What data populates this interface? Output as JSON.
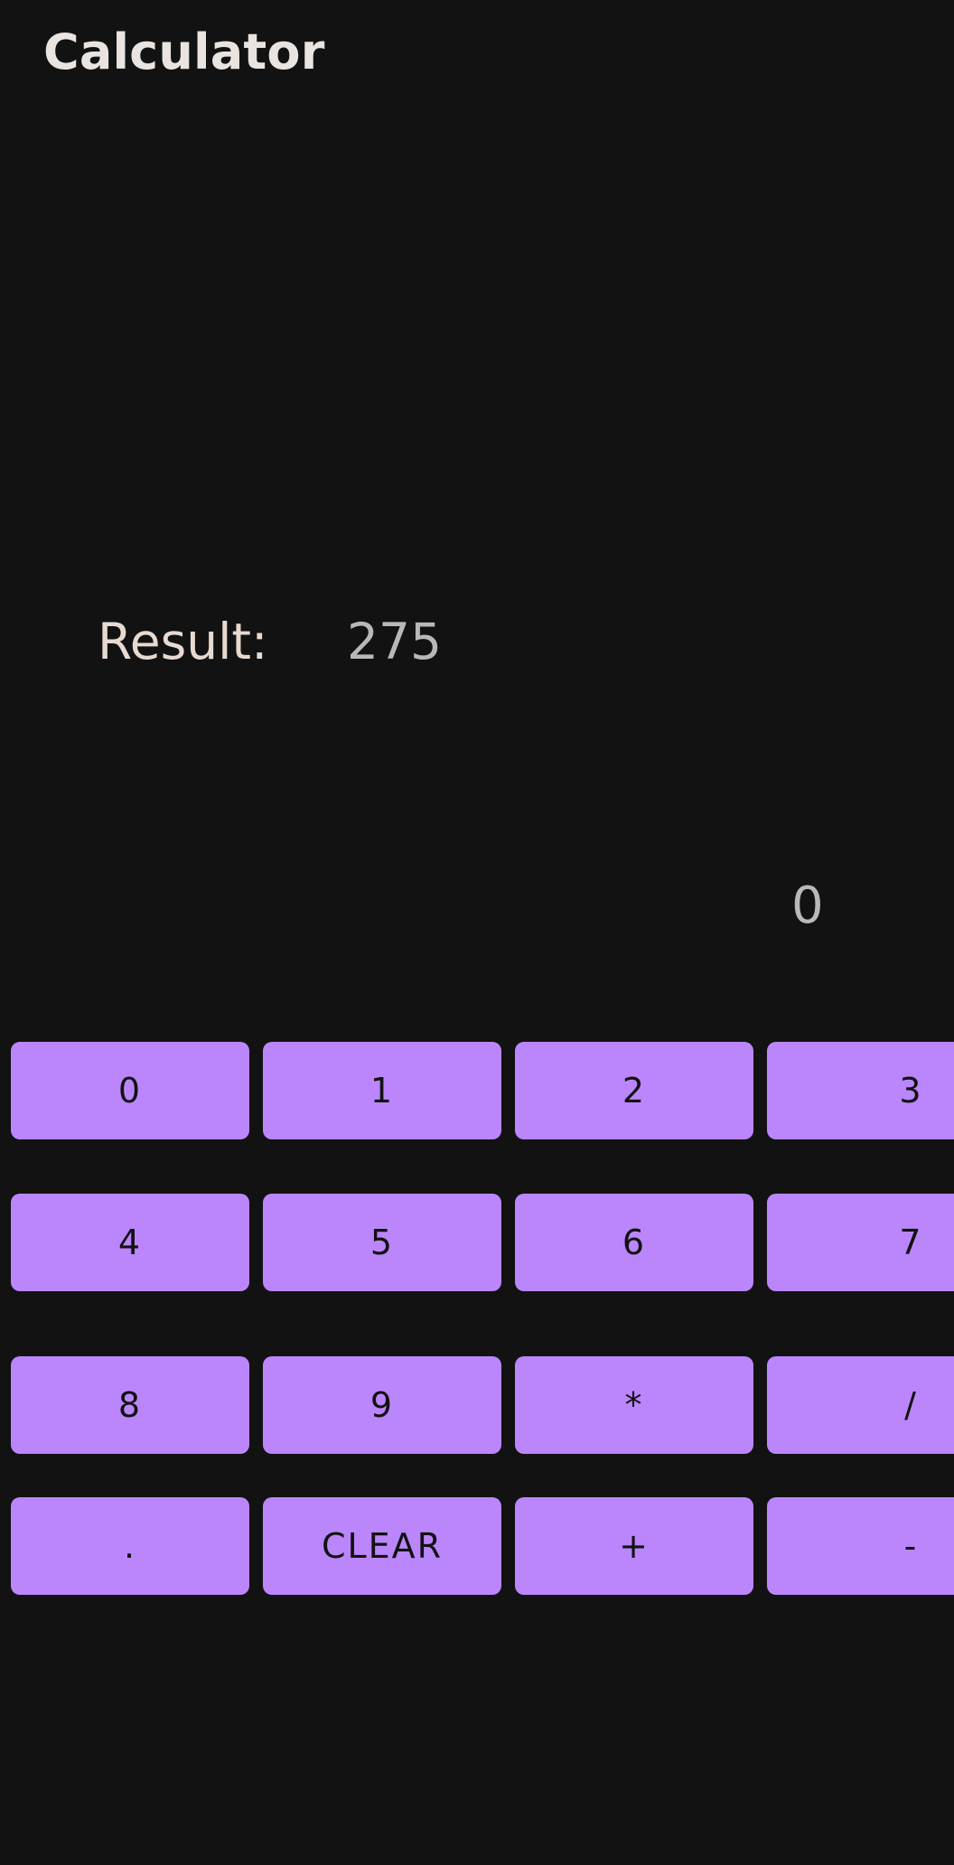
{
  "app": {
    "title": "Calculator"
  },
  "display": {
    "result_label": "Result:",
    "result_value": "275",
    "current_input": "0"
  },
  "keypad": {
    "keys": [
      "0",
      "1",
      "2",
      "3",
      "4",
      "5",
      "6",
      "7",
      "8",
      "9",
      "*",
      "/",
      ".",
      "CLEAR",
      "+",
      "-"
    ]
  },
  "colors": {
    "background": "#121212",
    "button": "#bb86fc",
    "button_text": "#121212",
    "title_text": "#e9e4df"
  }
}
